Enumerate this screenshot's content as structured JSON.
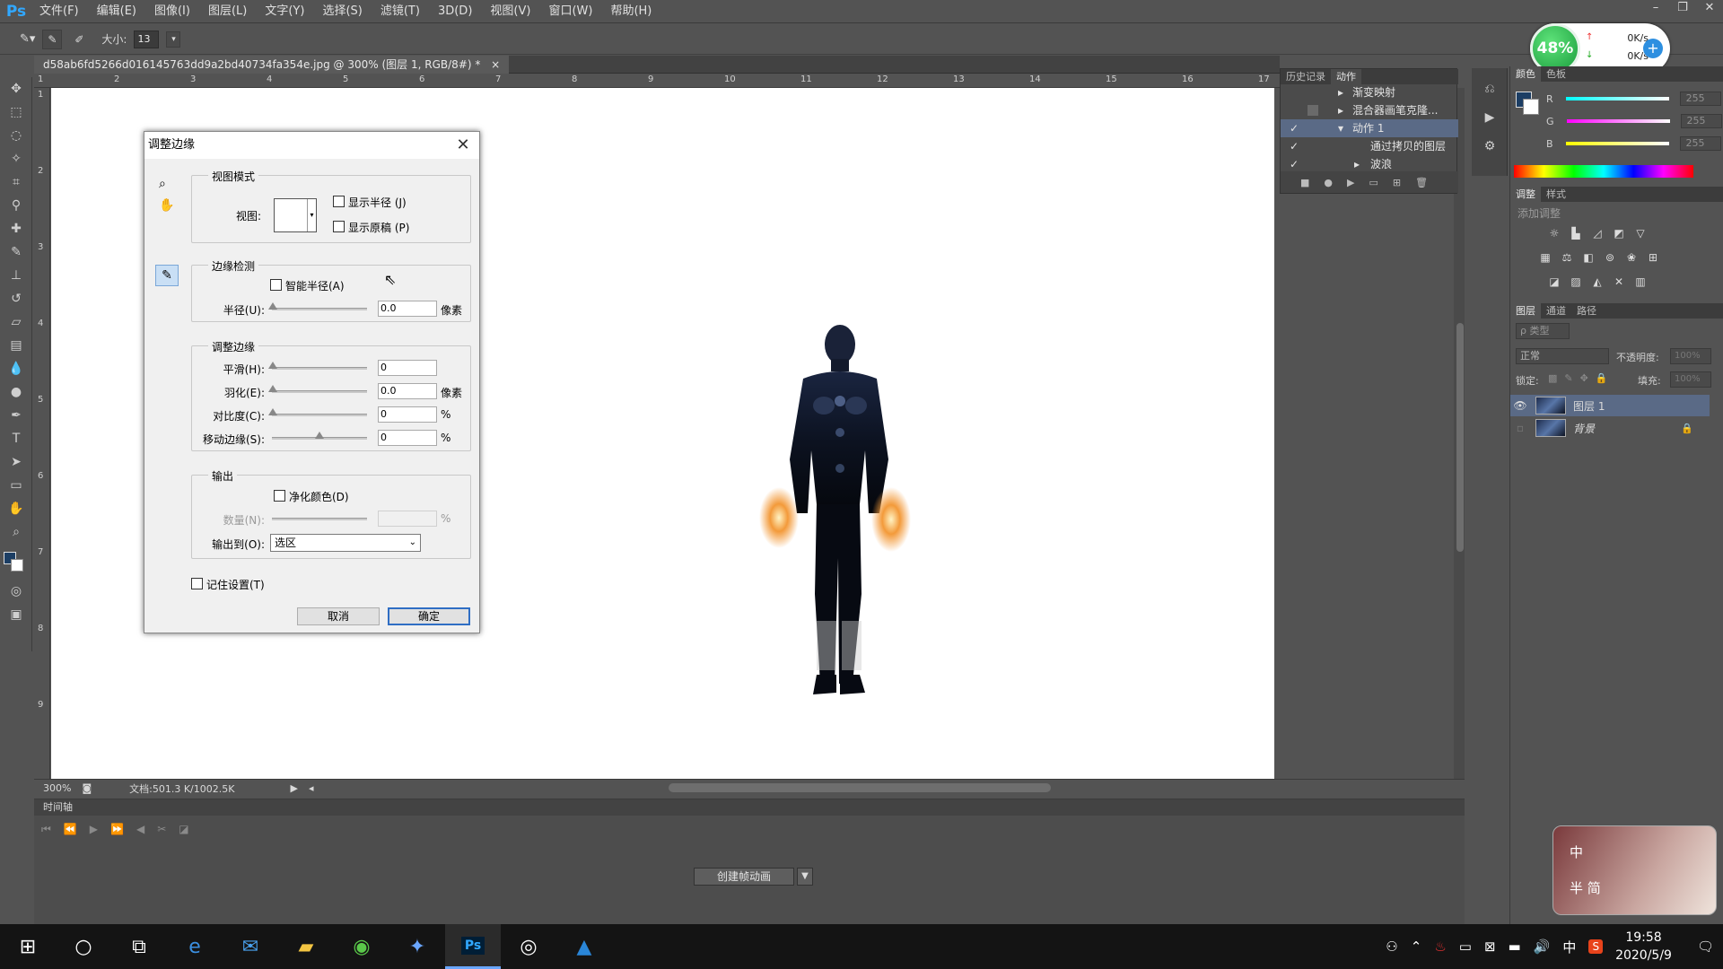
{
  "app": {
    "logo": "Ps"
  },
  "menu": [
    "文件(F)",
    "编辑(E)",
    "图像(I)",
    "图层(L)",
    "文字(Y)",
    "选择(S)",
    "滤镜(T)",
    "3D(D)",
    "视图(V)",
    "窗口(W)",
    "帮助(H)"
  ],
  "options": {
    "size_label": "大小:",
    "size_value": "13"
  },
  "net": {
    "percent": "48%",
    "up": "0K/s",
    "down": "0K/s"
  },
  "document": {
    "tab_title": "d58ab6fd5266d016145763dd9a2bd40734fa354e.jpg @ 300% (图层 1, RGB/8#) *",
    "ruler_h": [
      "1",
      "2",
      "3",
      "4",
      "5",
      "6",
      "7",
      "8",
      "9",
      "10",
      "11",
      "12",
      "13",
      "14",
      "15",
      "16",
      "17"
    ],
    "ruler_v": [
      "1",
      "2",
      "3",
      "4",
      "5",
      "6",
      "7",
      "8",
      "9"
    ],
    "zoom": "300%",
    "doc_info": "文档:501.3 K/1002.5K"
  },
  "timeline": {
    "title": "时间轴",
    "create_button": "创建帧动画"
  },
  "actions_panel": {
    "tabs": [
      "历史记录",
      "动作"
    ],
    "items": [
      "渐变映射",
      "混合器画笔克隆...",
      "动作 1",
      "通过拷贝的图层",
      "波浪"
    ]
  },
  "color_panel": {
    "tabs": [
      "颜色",
      "色板"
    ],
    "channels": [
      {
        "name": "R",
        "value": "255"
      },
      {
        "name": "G",
        "value": "255"
      },
      {
        "name": "B",
        "value": "255"
      }
    ]
  },
  "adjust_panel": {
    "tabs": [
      "调整",
      "样式"
    ],
    "add_label": "添加调整"
  },
  "layers_panel": {
    "tabs": [
      "图层",
      "通道",
      "路径"
    ],
    "kind_label": "ρ 类型",
    "blend_mode": "正常",
    "opacity_label": "不透明度:",
    "opacity_value": "100%",
    "lock_label": "锁定:",
    "fill_label": "填充:",
    "fill_value": "100%",
    "layers": [
      {
        "name": "图层 1"
      },
      {
        "name": "背景"
      }
    ]
  },
  "dialog": {
    "title": "调整边缘",
    "view_mode": {
      "group": "视图模式",
      "view_label": "视图:",
      "show_radius": "显示半径 (J)",
      "show_original": "显示原稿 (P)"
    },
    "edge_detection": {
      "group": "边缘检测",
      "smart_radius": "智能半径(A)",
      "radius_label": "半径(U):",
      "radius_value": "0.0",
      "radius_unit": "像素"
    },
    "adjust_edge": {
      "group": "调整边缘",
      "smooth_label": "平滑(H):",
      "smooth_value": "0",
      "feather_label": "羽化(E):",
      "feather_value": "0.0",
      "feather_unit": "像素",
      "contrast_label": "对比度(C):",
      "contrast_value": "0",
      "contrast_unit": "%",
      "shift_label": "移动边缘(S):",
      "shift_value": "0",
      "shift_unit": "%"
    },
    "output": {
      "group": "输出",
      "decontaminate": "净化颜色(D)",
      "amount_label": "数量(N):",
      "amount_unit": "%",
      "output_to_label": "输出到(O):",
      "output_to_value": "选区"
    },
    "remember": "记住设置(T)",
    "cancel": "取消",
    "ok": "确定"
  },
  "ime": {
    "line1": "中",
    "line2": "半  简"
  },
  "taskbar": {
    "clock_time": "19:58",
    "clock_date": "2020/5/9",
    "lang": "中"
  }
}
